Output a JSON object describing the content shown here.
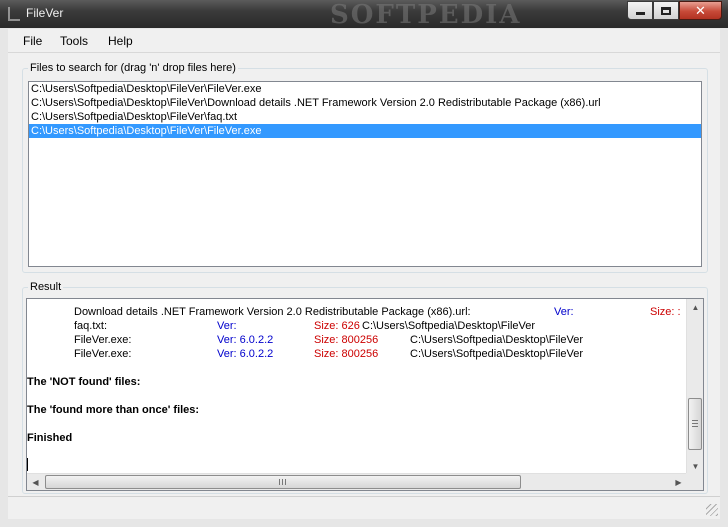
{
  "window": {
    "title": "FileVer",
    "watermark": "SOFTPEDIA"
  },
  "menu": [
    "File",
    "Tools",
    "Help"
  ],
  "files_group": {
    "label": "Files to search for (drag 'n' drop files here)",
    "items": [
      "C:\\Users\\Softpedia\\Desktop\\FileVer\\FileVer.exe",
      "C:\\Users\\Softpedia\\Desktop\\FileVer\\Download details .NET Framework Version 2.0 Redistributable Package (x86).url",
      "C:\\Users\\Softpedia\\Desktop\\FileVer\\faq.txt",
      "C:\\Users\\Softpedia\\Desktop\\FileVer\\FileVer.exe"
    ],
    "selected_index": 3
  },
  "result_group": {
    "label": "Result",
    "rows": [
      {
        "name": "Download details .NET Framework Version 2.0 Redistributable Package (x86).url:",
        "ver": "Ver:",
        "size": "Size: :",
        "path": ""
      },
      {
        "name": "faq.txt:",
        "ver": "Ver:",
        "size": "Size: 626",
        "path": "C:\\Users\\Softpedia\\Desktop\\FileVer"
      },
      {
        "name": "FileVer.exe:",
        "ver": "Ver: 6.0.2.2",
        "size": "Size: 800256",
        "path": "C:\\Users\\Softpedia\\Desktop\\FileVer"
      },
      {
        "name": "FileVer.exe:",
        "ver": "Ver: 6.0.2.2",
        "size": "Size: 800256",
        "path": "C:\\Users\\Softpedia\\Desktop\\FileVer"
      }
    ],
    "not_found_heading": "The 'NOT found' files:",
    "more_than_once_heading": "The 'found more than once' files:",
    "finished_text": "Finished"
  },
  "colors": {
    "selection": "#3399ff",
    "version_text": "#0000cc",
    "size_text": "#cc0000"
  },
  "icons": {
    "minimize": "minimize-icon",
    "maximize": "maximize-icon",
    "close": "close-icon",
    "scroll_up": "scroll-up-arrow-icon",
    "scroll_down": "scroll-down-arrow-icon",
    "scroll_left": "scroll-left-arrow-icon",
    "scroll_right": "scroll-right-arrow-icon"
  }
}
